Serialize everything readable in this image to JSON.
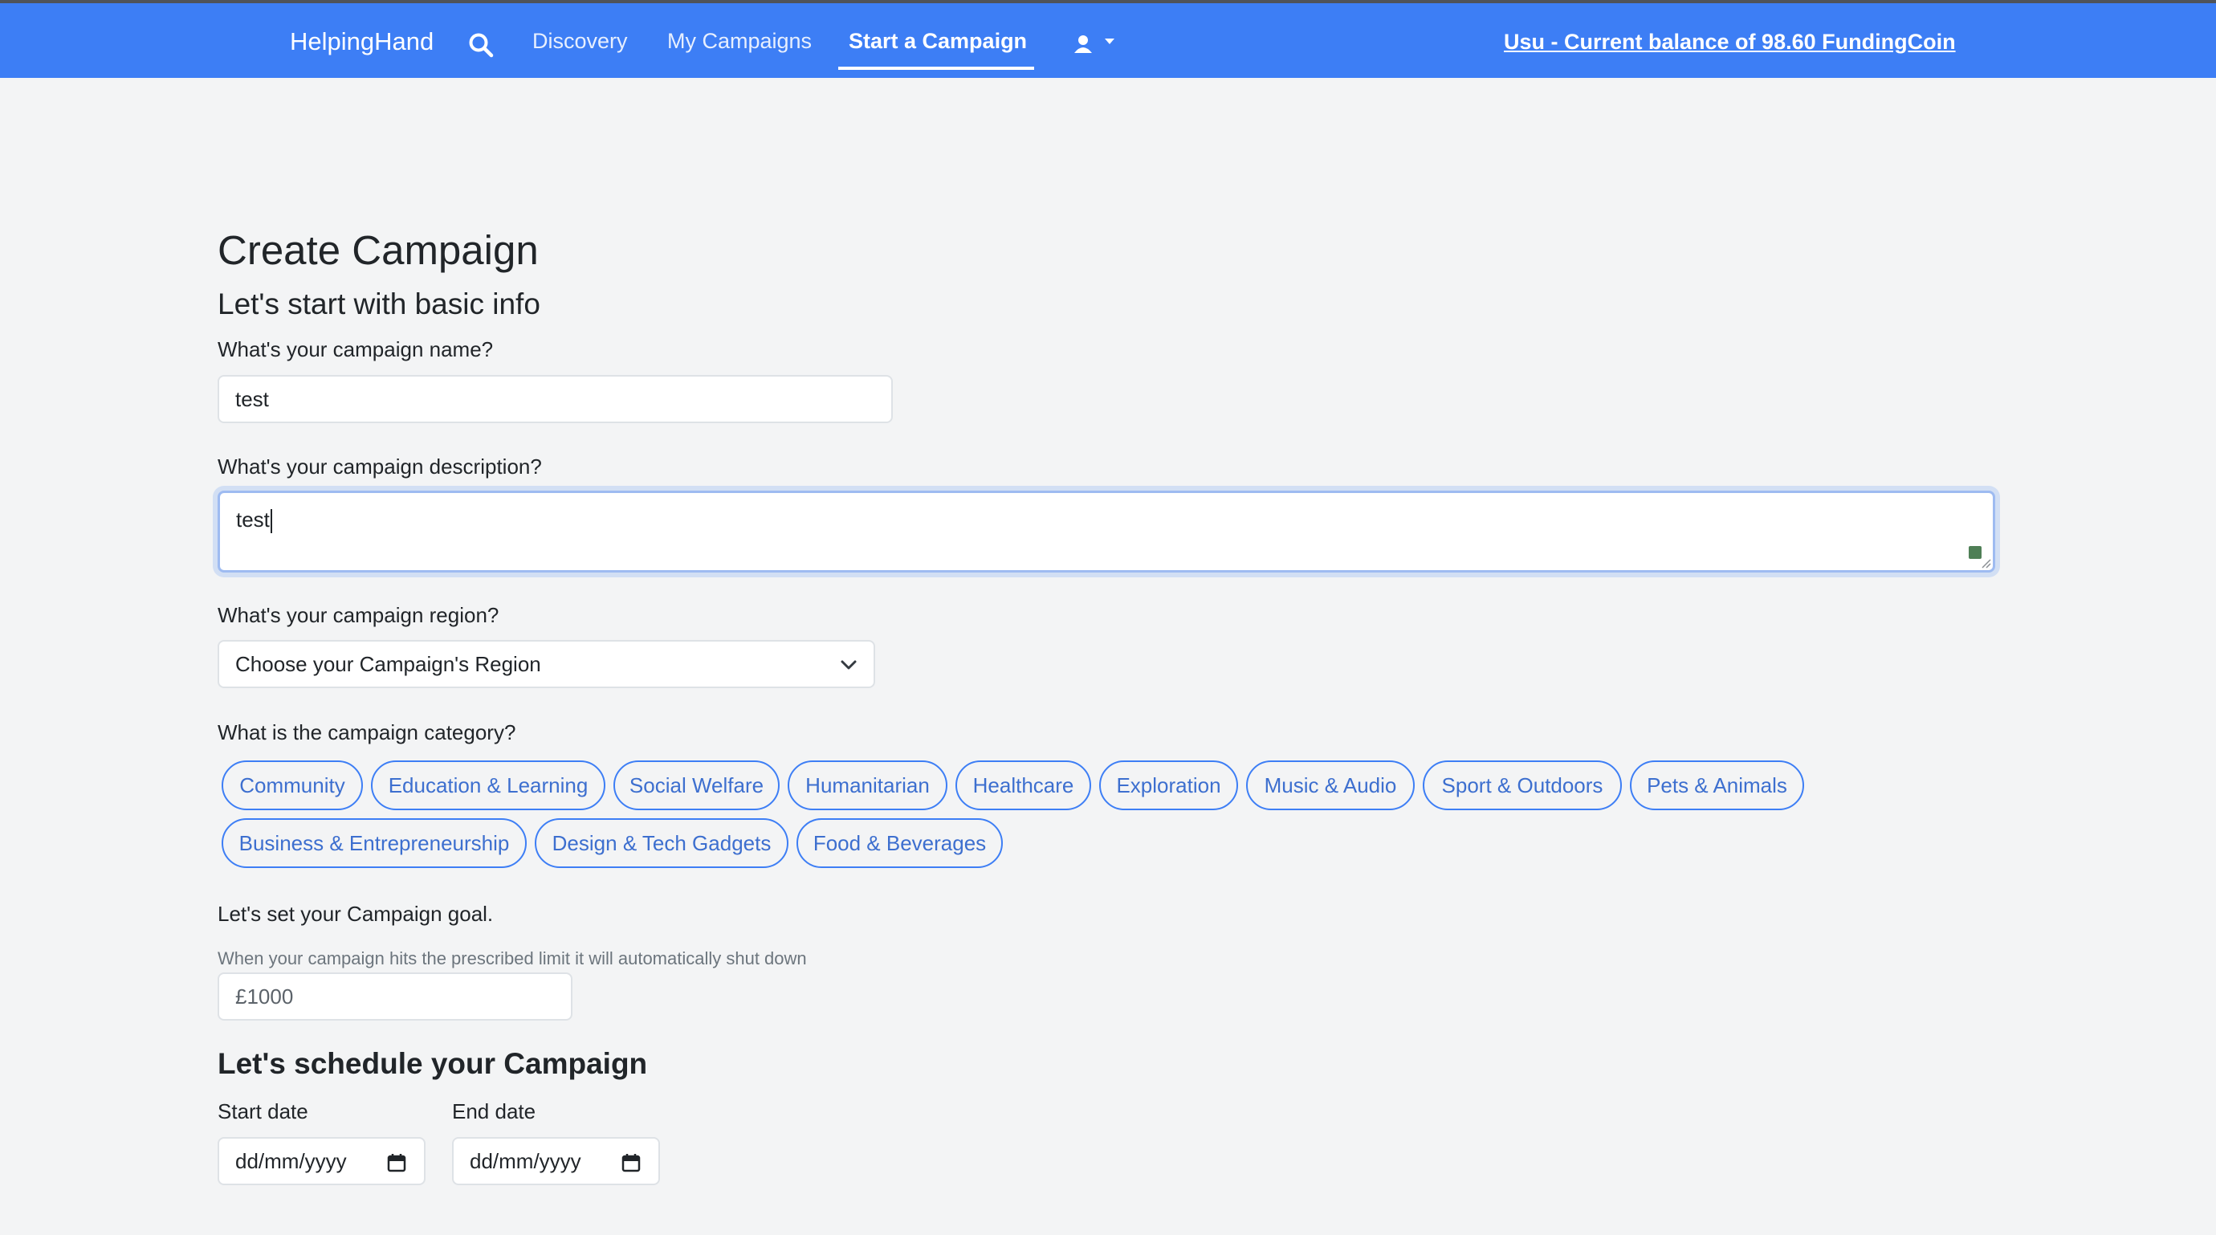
{
  "navbar": {
    "brand": "HelpingHand",
    "links": [
      {
        "label": "Discovery"
      },
      {
        "label": "My Campaigns"
      },
      {
        "label": "Start a Campaign",
        "active": true
      }
    ],
    "balance_text": "Usu - Current balance of 98.60 FundingCoin",
    "icons": [
      "search-icon",
      "user-icon",
      "caret-down-icon"
    ],
    "bg_color": "#3d7ef5"
  },
  "form": {
    "page_title": "Create Campaign",
    "basic_info_title": "Let's start with basic info",
    "name": {
      "label": "What's your campaign name?",
      "value": "test"
    },
    "description": {
      "label": "What's your campaign description?",
      "value": "test"
    },
    "region": {
      "label": "What's your campaign region?",
      "selected": "Choose your Campaign's Region"
    },
    "category": {
      "label": "What is the campaign category?",
      "options": [
        "Community",
        "Education & Learning",
        "Social Welfare",
        "Humanitarian",
        "Healthcare",
        "Exploration",
        "Music & Audio",
        "Sport & Outdoors",
        "Pets & Animals",
        "Business & Entrepreneurship",
        "Design & Tech Gadgets",
        "Food & Beverages"
      ]
    },
    "goal": {
      "label": "Let's set your Campaign goal.",
      "hint": "When your campaign hits the prescribed limit it will automatically shut down",
      "placeholder": "£1000"
    },
    "schedule": {
      "title": "Let's schedule your Campaign",
      "start_label": "Start date",
      "end_label": "End date",
      "date_placeholder": "dd/mm/yyyy"
    },
    "accent_color": "#3d7ef5"
  }
}
